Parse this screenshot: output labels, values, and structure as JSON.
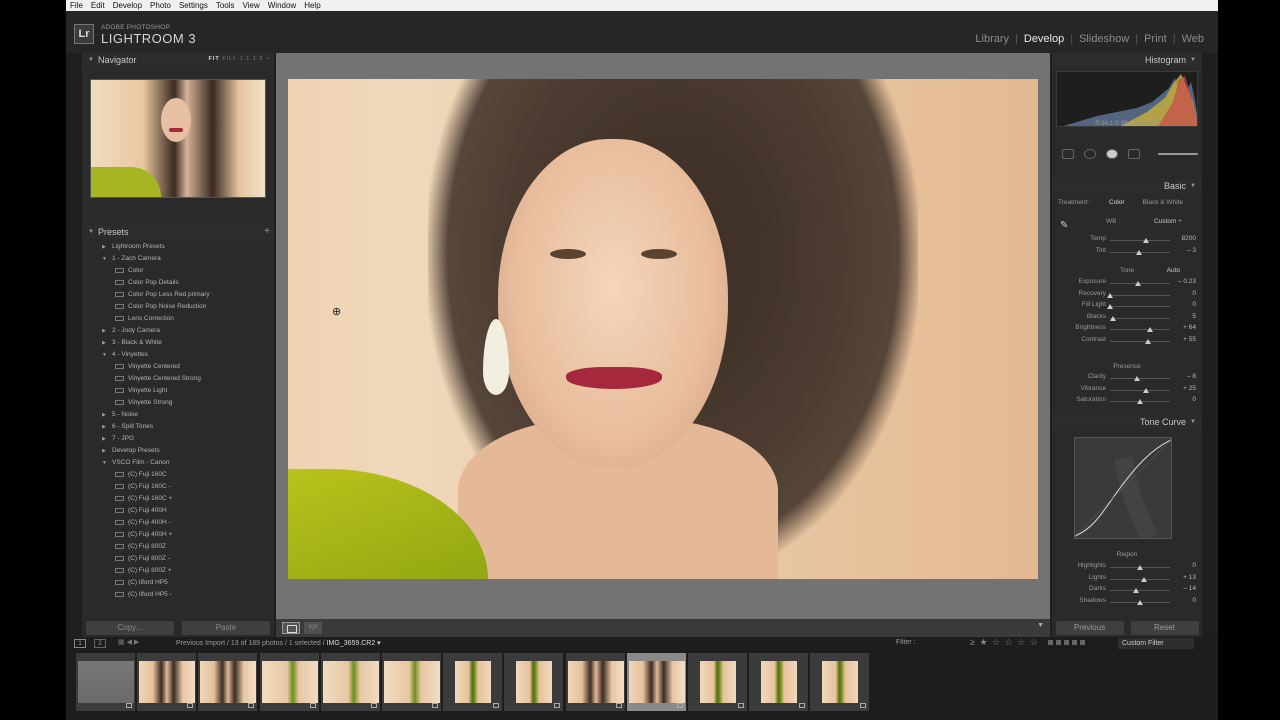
{
  "menu": [
    "File",
    "Edit",
    "Develop",
    "Photo",
    "Settings",
    "Tools",
    "View",
    "Window",
    "Help"
  ],
  "app": {
    "logo": "Lr",
    "brand_small": "ADOBE PHOTOSHOP",
    "brand_big": "LIGHTROOM 3"
  },
  "modules": [
    {
      "label": "Library",
      "active": false
    },
    {
      "label": "Develop",
      "active": true
    },
    {
      "label": "Slideshow",
      "active": false
    },
    {
      "label": "Print",
      "active": false
    },
    {
      "label": "Web",
      "active": false
    }
  ],
  "navigator": {
    "title": "Navigator",
    "zoom_fit": "FIT",
    "zoom_others": "FILL 1:1 1:2 ÷"
  },
  "presets": {
    "title": "Presets",
    "items": [
      {
        "type": "folder",
        "open": false,
        "label": "Lightroom Presets"
      },
      {
        "type": "folder",
        "open": true,
        "label": "1 - Zach Camera"
      },
      {
        "type": "preset",
        "label": "Color"
      },
      {
        "type": "preset",
        "label": "Color Pop Details"
      },
      {
        "type": "preset",
        "label": "Color Pop Less Red primary"
      },
      {
        "type": "preset",
        "label": "Color Pop Noise Reduction"
      },
      {
        "type": "preset",
        "label": "Lens Correction"
      },
      {
        "type": "folder",
        "open": false,
        "label": "2 - Jody Camera"
      },
      {
        "type": "folder",
        "open": false,
        "label": "3 - Black & White"
      },
      {
        "type": "folder",
        "open": true,
        "label": "4 - Vinyettes"
      },
      {
        "type": "preset",
        "label": "Vinyette Centered"
      },
      {
        "type": "preset",
        "label": "Vinyette Centered Strong"
      },
      {
        "type": "preset",
        "label": "Vinyette Light"
      },
      {
        "type": "preset",
        "label": "Vinyette Strong"
      },
      {
        "type": "folder",
        "open": false,
        "label": "5 - Noise"
      },
      {
        "type": "folder",
        "open": false,
        "label": "6 - Split Tones"
      },
      {
        "type": "folder",
        "open": false,
        "label": "7 - JPG"
      },
      {
        "type": "folder",
        "open": false,
        "label": "Develop Presets"
      },
      {
        "type": "folder",
        "open": true,
        "label": "VSCO Film - Canon"
      },
      {
        "type": "preset",
        "label": "(C) Fuji 160C"
      },
      {
        "type": "preset",
        "label": "(C) Fuji 160C -"
      },
      {
        "type": "preset",
        "label": "(C) Fuji 160C +"
      },
      {
        "type": "preset",
        "label": "(C) Fuji 400H"
      },
      {
        "type": "preset",
        "label": "(C) Fuji 400H -"
      },
      {
        "type": "preset",
        "label": "(C) Fuji 400H +"
      },
      {
        "type": "preset",
        "label": "(C) Fuji 800Z"
      },
      {
        "type": "preset",
        "label": "(C) Fuji 800Z -"
      },
      {
        "type": "preset",
        "label": "(C) Fuji 800Z +"
      },
      {
        "type": "preset",
        "label": "(C) Ilford HP5"
      },
      {
        "type": "preset",
        "label": "(C) Ilford HP5 -"
      },
      {
        "type": "preset",
        "label": "(C) Ilford HP5 +"
      }
    ]
  },
  "left_buttons": {
    "copy": "Copy...",
    "paste": "Paste"
  },
  "right": {
    "histogram_title": "Histogram",
    "readout": {
      "r": "94.1",
      "g": "89.0",
      "b": "82.7",
      "unit": "%"
    },
    "basic_title": "Basic",
    "treatment": {
      "label": "Treatment :",
      "color": "Color",
      "bw": "Black & White"
    },
    "wb": {
      "label": "WB :",
      "value": "Custom ÷"
    },
    "wb_sliders": [
      {
        "label": "Temp",
        "value": "8200",
        "pos": 0.6
      },
      {
        "label": "Tint",
        "value": "– 3",
        "pos": 0.48
      }
    ],
    "tone": {
      "label": "Tone",
      "auto": "Auto"
    },
    "tone_sliders": [
      {
        "label": "Exposure",
        "value": "– 0.23",
        "pos": 0.46
      },
      {
        "label": "Recovery",
        "value": "0",
        "pos": 0.0
      },
      {
        "label": "Fill Light",
        "value": "0",
        "pos": 0.0
      },
      {
        "label": "Blacks",
        "value": "5",
        "pos": 0.05
      },
      {
        "label": "Brightness",
        "value": "+ 64",
        "pos": 0.66
      },
      {
        "label": "Contrast",
        "value": "+ 55",
        "pos": 0.64
      }
    ],
    "presence": {
      "label": "Presence"
    },
    "presence_sliders": [
      {
        "label": "Clarity",
        "value": "– 8",
        "pos": 0.45
      },
      {
        "label": "Vibrance",
        "value": "+ 25",
        "pos": 0.6
      },
      {
        "label": "Saturation",
        "value": "0",
        "pos": 0.5
      }
    ],
    "tonecurve_title": "Tone Curve",
    "region": {
      "label": "Region"
    },
    "region_sliders": [
      {
        "label": "Highlights",
        "value": "0",
        "pos": 0.5
      },
      {
        "label": "Lights",
        "value": "+ 13",
        "pos": 0.56
      },
      {
        "label": "Darks",
        "value": "– 14",
        "pos": 0.43
      },
      {
        "label": "Shadows",
        "value": "0",
        "pos": 0.5
      }
    ],
    "previous": "Previous",
    "reset": "Reset"
  },
  "filmstrip": {
    "page1": "1",
    "page2": "2",
    "breadcrumb": "Previous Import / 13 of 189 photos / 1 selected /",
    "filename": "IMG_3659.CR2 ▾",
    "filter": "Filter :",
    "stars": "≥ ★ ☆ ☆ ☆ ☆",
    "custom_filter": "Custom Filter",
    "thumbs": [
      {
        "kind": "gray",
        "selected": false
      },
      {
        "kind": "portrait",
        "selected": false
      },
      {
        "kind": "portrait",
        "selected": false
      },
      {
        "kind": "full",
        "selected": false
      },
      {
        "kind": "full",
        "selected": false
      },
      {
        "kind": "full",
        "selected": false
      },
      {
        "kind": "vertical",
        "selected": false
      },
      {
        "kind": "vertical",
        "selected": false
      },
      {
        "kind": "portrait",
        "selected": false
      },
      {
        "kind": "portrait",
        "selected": true
      },
      {
        "kind": "vertical",
        "selected": false
      },
      {
        "kind": "vertical",
        "selected": false
      },
      {
        "kind": "vertical",
        "selected": false
      }
    ]
  }
}
